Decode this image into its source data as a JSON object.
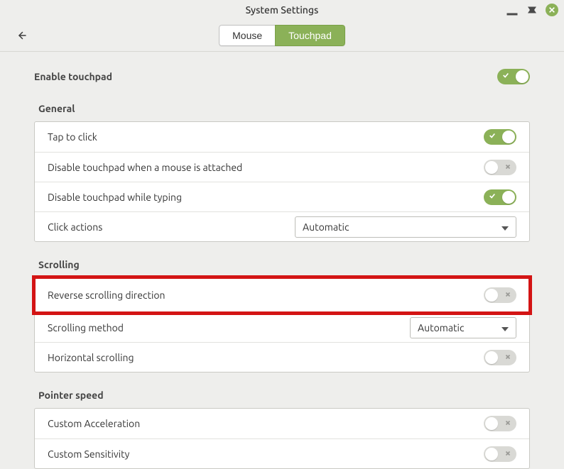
{
  "window": {
    "title": "System Settings"
  },
  "tabs": {
    "mouse": "Mouse",
    "touchpad": "Touchpad",
    "active": "touchpad"
  },
  "enable": {
    "label": "Enable touchpad",
    "on": true
  },
  "sections": {
    "general": {
      "title": "General",
      "tap_to_click": {
        "label": "Tap to click",
        "on": true
      },
      "disable_mouse": {
        "label": "Disable touchpad when a mouse is attached",
        "on": false
      },
      "disable_typing": {
        "label": "Disable touchpad while typing",
        "on": true
      },
      "click_actions": {
        "label": "Click actions",
        "value": "Automatic"
      }
    },
    "scrolling": {
      "title": "Scrolling",
      "reverse": {
        "label": "Reverse scrolling direction",
        "on": false
      },
      "method": {
        "label": "Scrolling method",
        "value": "Automatic"
      },
      "horizontal": {
        "label": "Horizontal scrolling",
        "on": false
      }
    },
    "pointer": {
      "title": "Pointer speed",
      "accel": {
        "label": "Custom Acceleration",
        "on": false
      },
      "sens": {
        "label": "Custom Sensitivity",
        "on": false
      }
    }
  }
}
